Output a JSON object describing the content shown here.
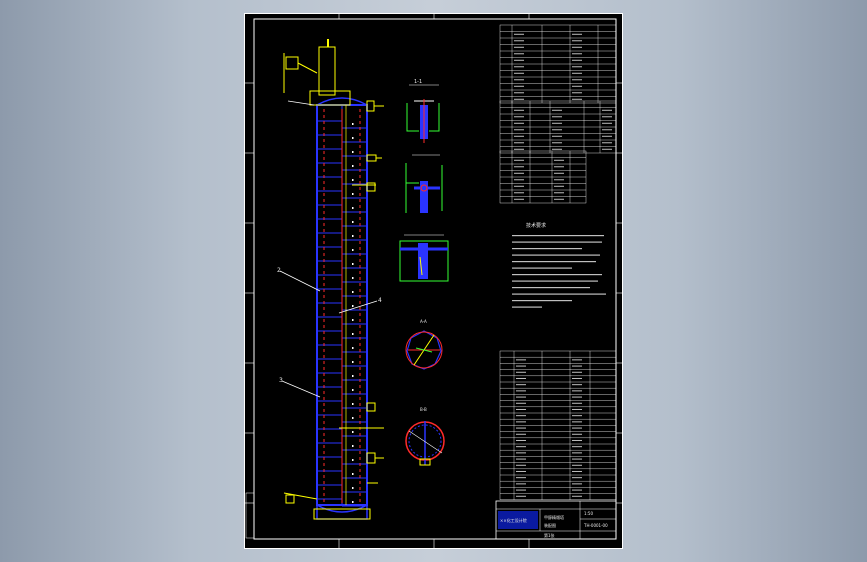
{
  "drawing": {
    "label_top_a": "A",
    "label_top_b": "B",
    "label_top_c": "C",
    "label_top_d": "D",
    "section_1": "1-1",
    "section_2": "2-2",
    "section_3": "3-3",
    "section_4": "A-A",
    "section_5": "B-B",
    "notes_title": "技术要求",
    "title_company": "××化工设计院",
    "title_name": "甲醇精馏塔",
    "title_drawing": "装配图",
    "title_scale": "1:50",
    "title_sheet": "第1张",
    "title_number": "TH-0001-00"
  },
  "colors": {
    "paper": "#000000",
    "frame": "#ffffff",
    "vessel": "#2a34ff",
    "trays": "#ff2a2a",
    "leaders": "#ffff00",
    "details": "#33ff33"
  }
}
